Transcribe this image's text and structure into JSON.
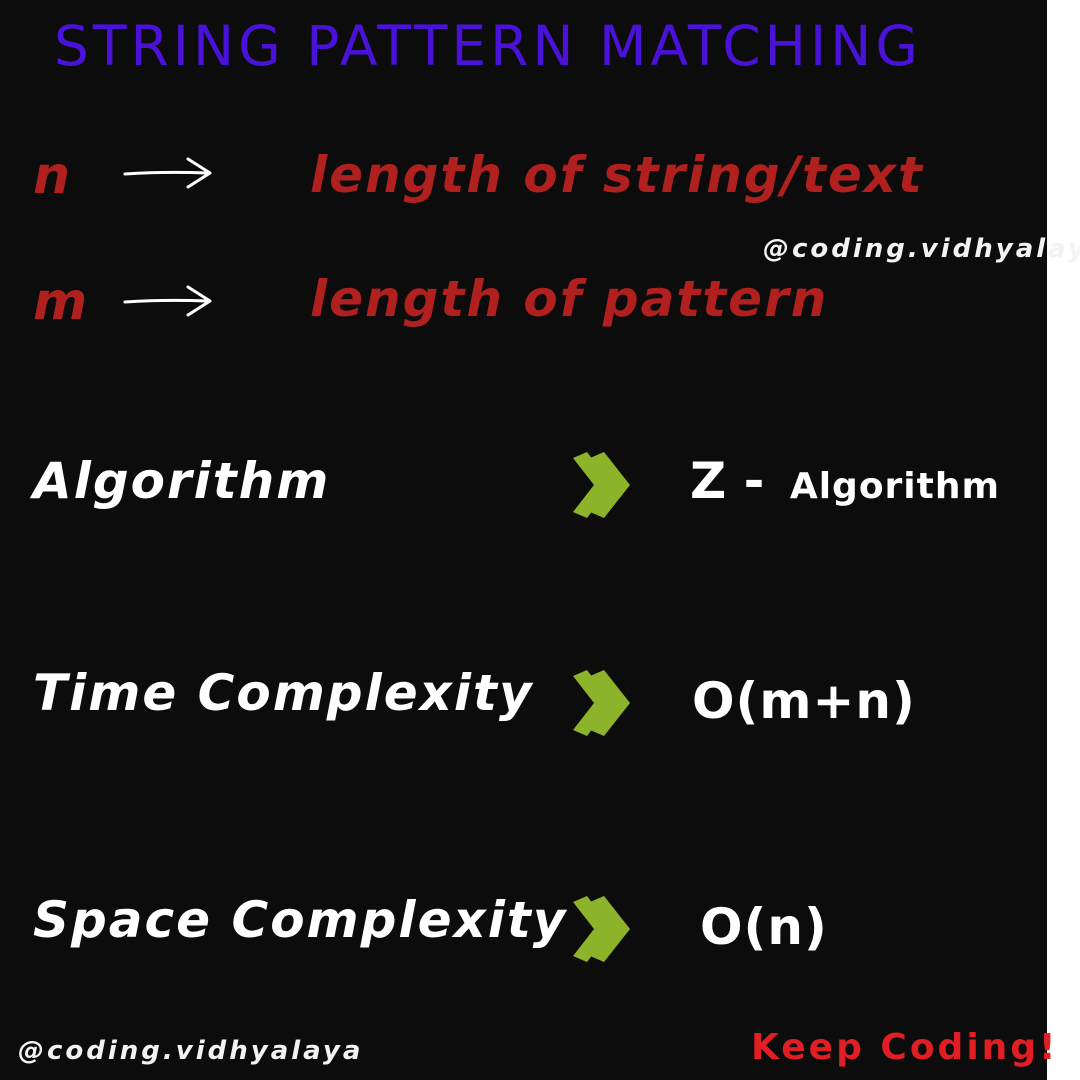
{
  "title": "STRING PATTERN MATCHING",
  "definitions": [
    {
      "symbol": "n",
      "arrow_icon": "right-arrow-icon",
      "meaning": "length of string/text"
    },
    {
      "symbol": "m",
      "arrow_icon": "right-arrow-icon",
      "meaning": "length of pattern"
    }
  ],
  "rows": [
    {
      "label": "Algorithm",
      "icon": "double-chevron-right-icon",
      "value_main": "Z -",
      "value_small": "Algorithm"
    },
    {
      "label": "Time Complexity",
      "icon": "double-chevron-right-icon",
      "value": "O(m+n)"
    },
    {
      "label": "Space Complexity",
      "icon": "double-chevron-right-icon",
      "value": "O(n)"
    }
  ],
  "watermark": "@coding.vidhyalaya",
  "footer": {
    "handle": "@coding.vidhyalaya",
    "signoff": "Keep Coding!"
  },
  "colors": {
    "background": "#0c0c0c",
    "title": "#4a12d9",
    "definition_text": "#b0201f",
    "chevron": "#8db32a",
    "signoff": "#e11e24",
    "body_text": "#ffffff"
  }
}
